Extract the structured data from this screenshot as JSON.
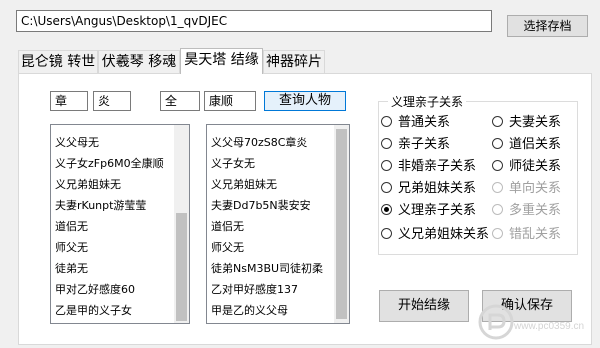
{
  "path": {
    "value": "C:\\Users\\Angus\\Desktop\\1_qvDJEC"
  },
  "toolbar": {
    "choose_label": "选择存档"
  },
  "tabs": [
    {
      "label": "昆仑镜 转世",
      "active": false
    },
    {
      "label": "伏羲琴 移魂",
      "active": false
    },
    {
      "label": "昊天塔 结缘",
      "active": true
    },
    {
      "label": "神器碎片",
      "active": false
    }
  ],
  "search": {
    "left_surname": "章",
    "left_given": "炎",
    "right_surname": "全",
    "right_given": "康顺",
    "query_label": "查询人物"
  },
  "left_list": {
    "items": [
      "义父母无",
      "义子女zFp6M0全康顺",
      "义兄弟姐妹无",
      "夫妻rKunpt游莹莹",
      "道侣无",
      "师父无",
      "徒弟无",
      "甲对乙好感度60",
      "乙是甲的义子女"
    ]
  },
  "right_list": {
    "items": [
      "义父母70zS8C章炎",
      "义子女无",
      "义兄弟姐妹无",
      "夫妻Dd7b5N裴安安",
      "道侣无",
      "师父无",
      "徒弟NsM3BU司徒初柔",
      "乙对甲好感度137",
      "甲是乙的义父母"
    ]
  },
  "relations": {
    "title": "义理亲子关系",
    "options": [
      {
        "label": "普通关系",
        "checked": false,
        "enabled": true
      },
      {
        "label": "夫妻关系",
        "checked": false,
        "enabled": true
      },
      {
        "label": "亲子关系",
        "checked": false,
        "enabled": true
      },
      {
        "label": "道侣关系",
        "checked": false,
        "enabled": true
      },
      {
        "label": "非婚亲子关系",
        "checked": false,
        "enabled": true
      },
      {
        "label": "师徒关系",
        "checked": false,
        "enabled": true
      },
      {
        "label": "兄弟姐妹关系",
        "checked": false,
        "enabled": true
      },
      {
        "label": "单向关系",
        "checked": false,
        "enabled": false
      },
      {
        "label": "义理亲子关系",
        "checked": true,
        "enabled": true
      },
      {
        "label": "多重关系",
        "checked": false,
        "enabled": false
      },
      {
        "label": "义兄弟姐妹关系",
        "checked": false,
        "enabled": true
      },
      {
        "label": "错乱关系",
        "checked": false,
        "enabled": false
      }
    ]
  },
  "actions": {
    "start_label": "开始结缘",
    "save_label": "确认保存"
  },
  "watermark": {
    "text": "www.pc0359.cn"
  }
}
